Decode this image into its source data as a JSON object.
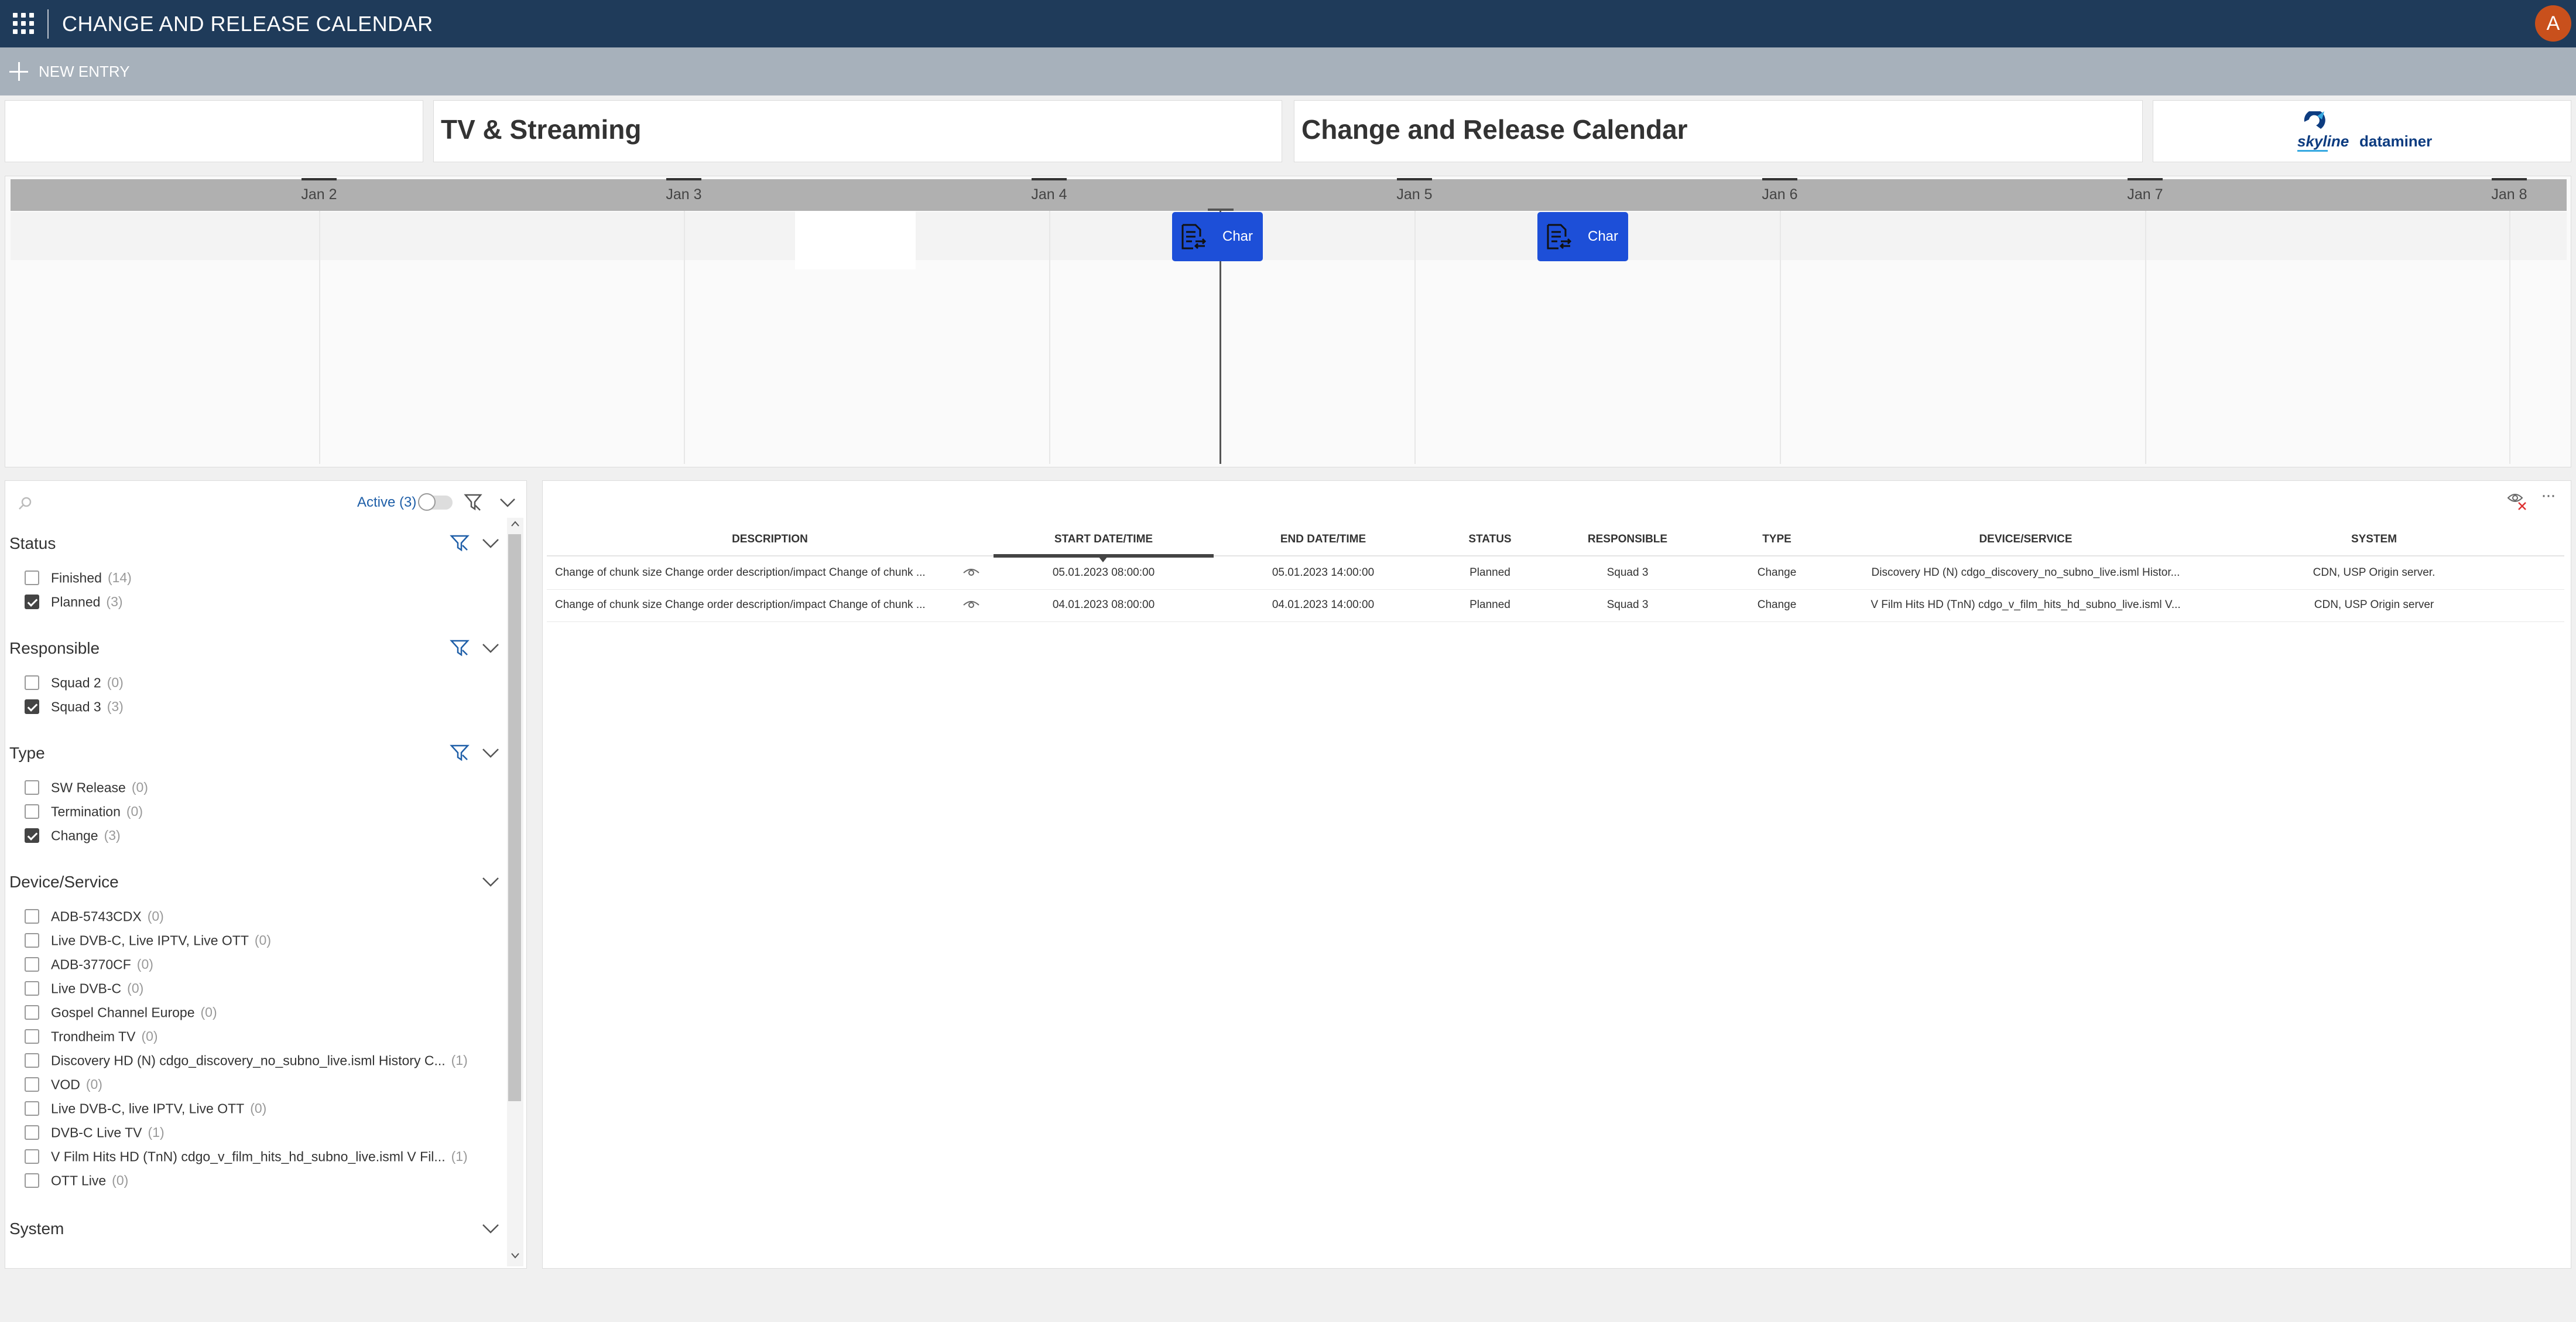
{
  "app": {
    "title": "CHANGE AND RELEASE CALENDAR",
    "avatar_initial": "A"
  },
  "actionbar": {
    "new_entry": "NEW ENTRY"
  },
  "header_cards": {
    "card2_title": "TV & Streaming",
    "card3_title": "Change and Release Calendar",
    "logo_left": "skyline",
    "logo_right": "dataminer"
  },
  "timeline": {
    "ticks": [
      "Jan 2",
      "Jan 3",
      "Jan 4",
      "Jan 5",
      "Jan 6",
      "Jan 7",
      "Jan 8"
    ],
    "events": [
      {
        "label": "Char",
        "icon": "change-document-icon"
      },
      {
        "label": "Char",
        "icon": "change-document-icon"
      }
    ]
  },
  "filters": {
    "active_label": "Active (3)",
    "sections": {
      "status": {
        "title": "Status",
        "items": [
          {
            "label": "Finished",
            "count": "(14)",
            "checked": false
          },
          {
            "label": "Planned",
            "count": "(3)",
            "checked": true
          }
        ]
      },
      "responsible": {
        "title": "Responsible",
        "items": [
          {
            "label": "Squad 2",
            "count": "(0)",
            "checked": false
          },
          {
            "label": "Squad 3",
            "count": "(3)",
            "checked": true
          }
        ]
      },
      "type": {
        "title": "Type",
        "items": [
          {
            "label": "SW Release",
            "count": "(0)",
            "checked": false
          },
          {
            "label": "Termination",
            "count": "(0)",
            "checked": false
          },
          {
            "label": "Change",
            "count": "(3)",
            "checked": true
          }
        ]
      },
      "device_service": {
        "title": "Device/Service",
        "items": [
          {
            "label": "ADB-5743CDX",
            "count": "(0)",
            "checked": false
          },
          {
            "label": "Live DVB-C, Live IPTV, Live OTT",
            "count": "(0)",
            "checked": false
          },
          {
            "label": "ADB-3770CF",
            "count": "(0)",
            "checked": false
          },
          {
            "label": "Live DVB-C",
            "count": "(0)",
            "checked": false
          },
          {
            "label": "Gospel Channel Europe",
            "count": "(0)",
            "checked": false
          },
          {
            "label": "Trondheim TV",
            "count": "(0)",
            "checked": false
          },
          {
            "label": "Discovery HD (N) cdgo_discovery_no_subno_live.isml History C...",
            "count": "(1)",
            "checked": false
          },
          {
            "label": "VOD",
            "count": "(0)",
            "checked": false
          },
          {
            "label": "Live DVB-C, live IPTV, Live OTT",
            "count": "(0)",
            "checked": false
          },
          {
            "label": "DVB-C Live TV",
            "count": "(1)",
            "checked": false
          },
          {
            "label": "V Film Hits HD (TnN) cdgo_v_film_hits_hd_subno_live.isml V Fil...",
            "count": "(1)",
            "checked": false
          },
          {
            "label": "OTT Live",
            "count": "(0)",
            "checked": false
          }
        ]
      },
      "system": {
        "title": "System"
      }
    }
  },
  "table": {
    "columns": [
      "DESCRIPTION",
      "START DATE/TIME",
      "END DATE/TIME",
      "STATUS",
      "RESPONSIBLE",
      "TYPE",
      "DEVICE/SERVICE",
      "SYSTEM"
    ],
    "rows": [
      {
        "description": "Change of chunk size Change order description/impact Change of chunk ...",
        "start": "05.01.2023 08:00:00",
        "end": "05.01.2023 14:00:00",
        "status": "Planned",
        "responsible": "Squad 3",
        "type": "Change",
        "device": "Discovery HD (N) cdgo_discovery_no_subno_live.isml Histor...",
        "system": "CDN, USP Origin server."
      },
      {
        "description": "Change of chunk size Change order description/impact Change of chunk ...",
        "start": "04.01.2023 08:00:00",
        "end": "04.01.2023 14:00:00",
        "status": "Planned",
        "responsible": "Squad 3",
        "type": "Change",
        "device": "V Film Hits HD (TnN) cdgo_v_film_hits_hd_subno_live.isml V...",
        "system": "CDN, USP Origin server"
      }
    ]
  },
  "colors": {
    "topbar": "#1f3b5a",
    "actionbar": "#a7b1bb",
    "event": "#1d4fd8",
    "avatar": "#c9501c"
  }
}
